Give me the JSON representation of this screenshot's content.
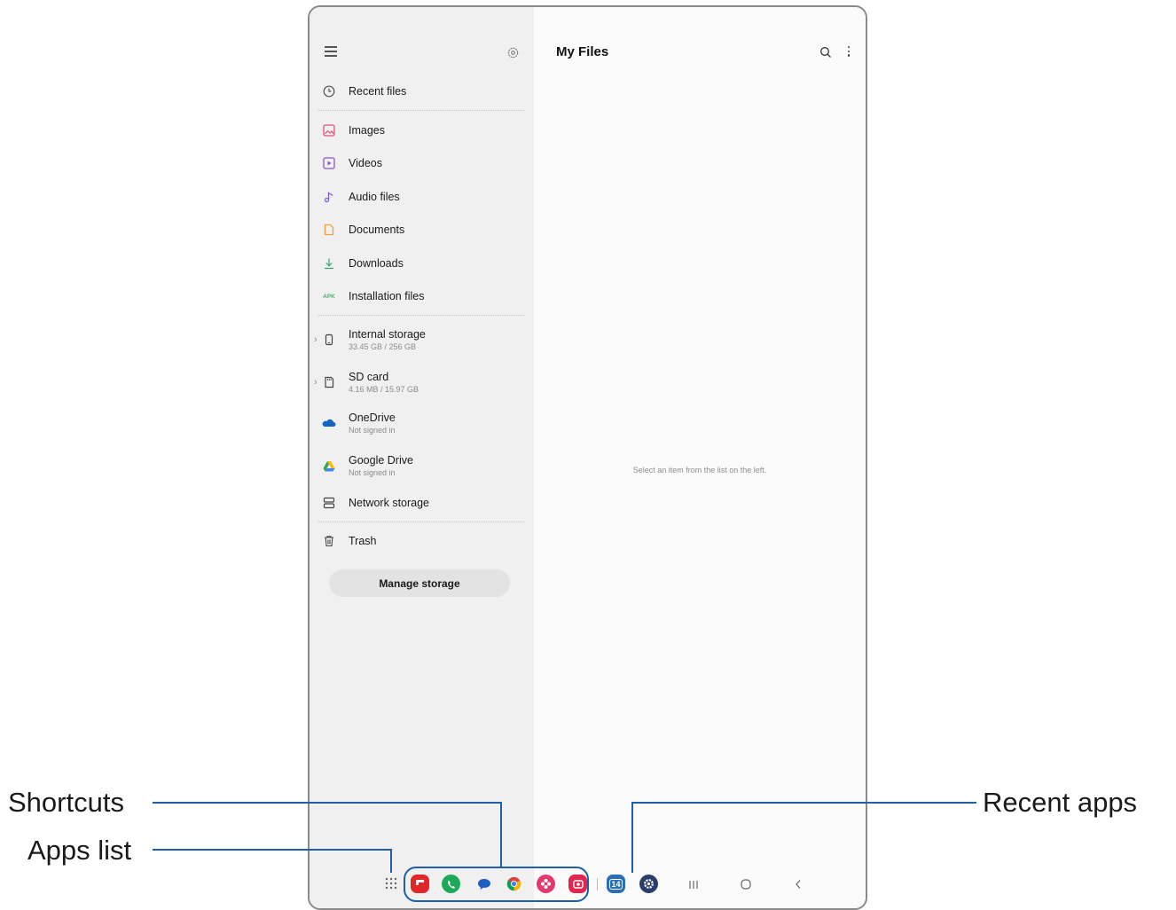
{
  "sidebar": {
    "items": [
      {
        "label": "Recent files",
        "icon": "clock-icon"
      },
      {
        "label": "Images",
        "icon": "image-icon"
      },
      {
        "label": "Videos",
        "icon": "video-icon"
      },
      {
        "label": "Audio files",
        "icon": "music-note-icon"
      },
      {
        "label": "Documents",
        "icon": "document-icon"
      },
      {
        "label": "Downloads",
        "icon": "download-icon"
      },
      {
        "label": "Installation files",
        "icon": "apk-icon",
        "icon_text": "APK"
      }
    ],
    "storage": [
      {
        "label": "Internal storage",
        "sub": "33.45 GB / 256 GB",
        "icon": "phone-icon"
      },
      {
        "label": "SD card",
        "sub": "4.16 MB / 15.97 GB",
        "icon": "sd-card-icon"
      },
      {
        "label": "OneDrive",
        "sub": "Not signed in",
        "icon": "onedrive-icon"
      },
      {
        "label": "Google Drive",
        "sub": "Not signed in",
        "icon": "google-drive-icon"
      },
      {
        "label": "Network storage",
        "icon": "network-storage-icon"
      }
    ],
    "trash": {
      "label": "Trash",
      "icon": "trash-icon"
    },
    "manage_button": "Manage storage"
  },
  "main": {
    "title": "My Files",
    "empty_message": "Select an item from the list on the left."
  },
  "taskbar": {
    "apps_list_icon": "apps-grid-icon",
    "shortcuts": [
      "flipboard-icon",
      "phone-icon",
      "messages-icon",
      "chrome-icon",
      "gallery-icon",
      "camera-icon"
    ],
    "recent": [
      "calendar-icon",
      "settings-icon"
    ],
    "calendar_day": "14",
    "nav": [
      "recents-nav-icon",
      "home-nav-icon",
      "back-nav-icon"
    ]
  },
  "callouts": {
    "shortcuts": "Shortcuts",
    "apps_list": "Apps list",
    "recent_apps": "Recent apps"
  },
  "colors": {
    "callout_line": "#1f5fa6",
    "images": "#e0547a",
    "videos": "#8a56c9",
    "audio": "#7a5cd6",
    "documents": "#f1a33a",
    "downloads": "#3aa66b",
    "apk": "#45b36b"
  }
}
